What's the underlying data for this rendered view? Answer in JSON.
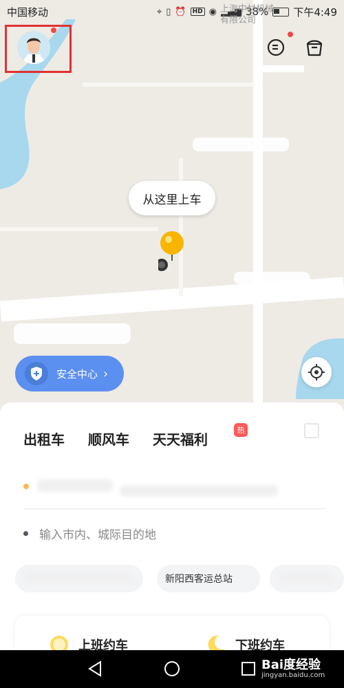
{
  "status_bar": {
    "carrier": "中国移动",
    "hd": "HD",
    "battery": "38%",
    "time": "下午4:49"
  },
  "map_overlay": {
    "company_label_1": "上海中材机械",
    "company_label_2": "有限公司"
  },
  "map": {
    "pickup_bubble": "从这里上车"
  },
  "safety_center": {
    "label": "安全中心"
  },
  "panel": {
    "tabs": [
      {
        "label": "出租车",
        "active": false
      },
      {
        "label": "顺风车",
        "active": true
      },
      {
        "label": "天天福利",
        "active": false
      }
    ],
    "hot_badge": "热",
    "destination_placeholder": "输入市内、城际目的地",
    "chips": [
      "新阳西客运总站"
    ],
    "commute": [
      {
        "label": "上班约车"
      },
      {
        "label": "下班约车"
      }
    ]
  },
  "watermark": {
    "brand": "Bai度经验",
    "url": "jingyan.baidu.com"
  },
  "colors": {
    "accent_blue": "#5b8ff0",
    "highlight_yellow": "#ffd95a",
    "alert_red": "#f04848",
    "pin_yellow": "#f7b500"
  }
}
